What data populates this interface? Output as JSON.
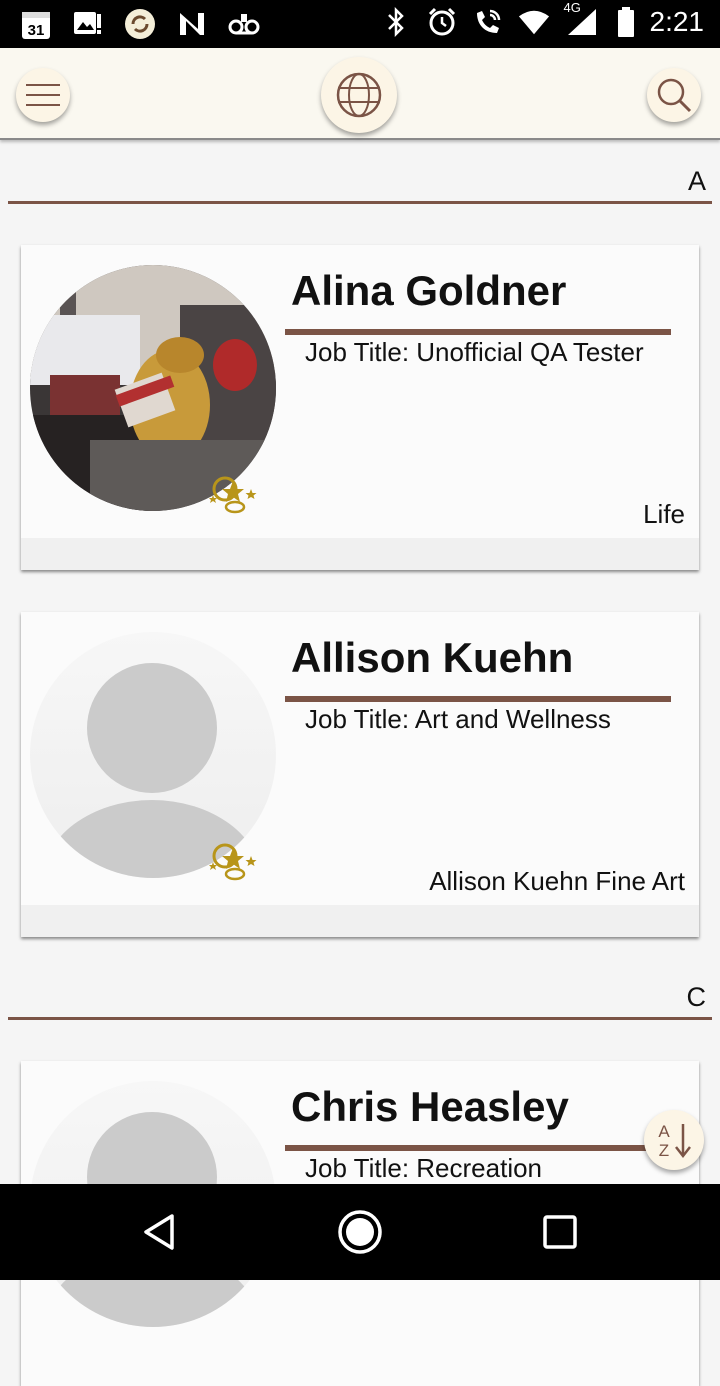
{
  "status_bar": {
    "time": "2:21",
    "network": "4G",
    "icons_left": [
      "calendar-icon",
      "image-alert-icon",
      "sync-app-icon",
      "n-app-icon",
      "voicemail-icon"
    ],
    "icons_right": [
      "bluetooth-icon",
      "alarm-icon",
      "phone-wifi-icon",
      "wifi-icon",
      "cell-signal-icon",
      "battery-icon"
    ],
    "calendar_day": "31"
  },
  "app_bar": {
    "menu_icon": "hamburger-menu-icon",
    "center_icon": "globe-icon",
    "search_icon": "search-icon"
  },
  "sections": [
    {
      "letter": "A"
    },
    {
      "letter": "C"
    }
  ],
  "contacts": [
    {
      "name": "Alina Goldner",
      "job": "Job Title: Unofficial QA Tester",
      "org": "Life",
      "avatar": "photo"
    },
    {
      "name": "Allison Kuehn",
      "job": "Job Title: Art and Wellness",
      "org": "Allison Kuehn Fine Art",
      "avatar": "placeholder"
    },
    {
      "name": "Chris Heasley",
      "job": "Job Title: Recreation",
      "org": "",
      "avatar": "placeholder"
    }
  ],
  "sort_button": {
    "icon": "sort-alpha-icon",
    "top": "A",
    "bottom": "Z"
  },
  "colors": {
    "accent": "#7b5446",
    "appbar_bg": "#faf8f0",
    "button_bg": "#fcf5e6",
    "badge": "#b8951a"
  }
}
